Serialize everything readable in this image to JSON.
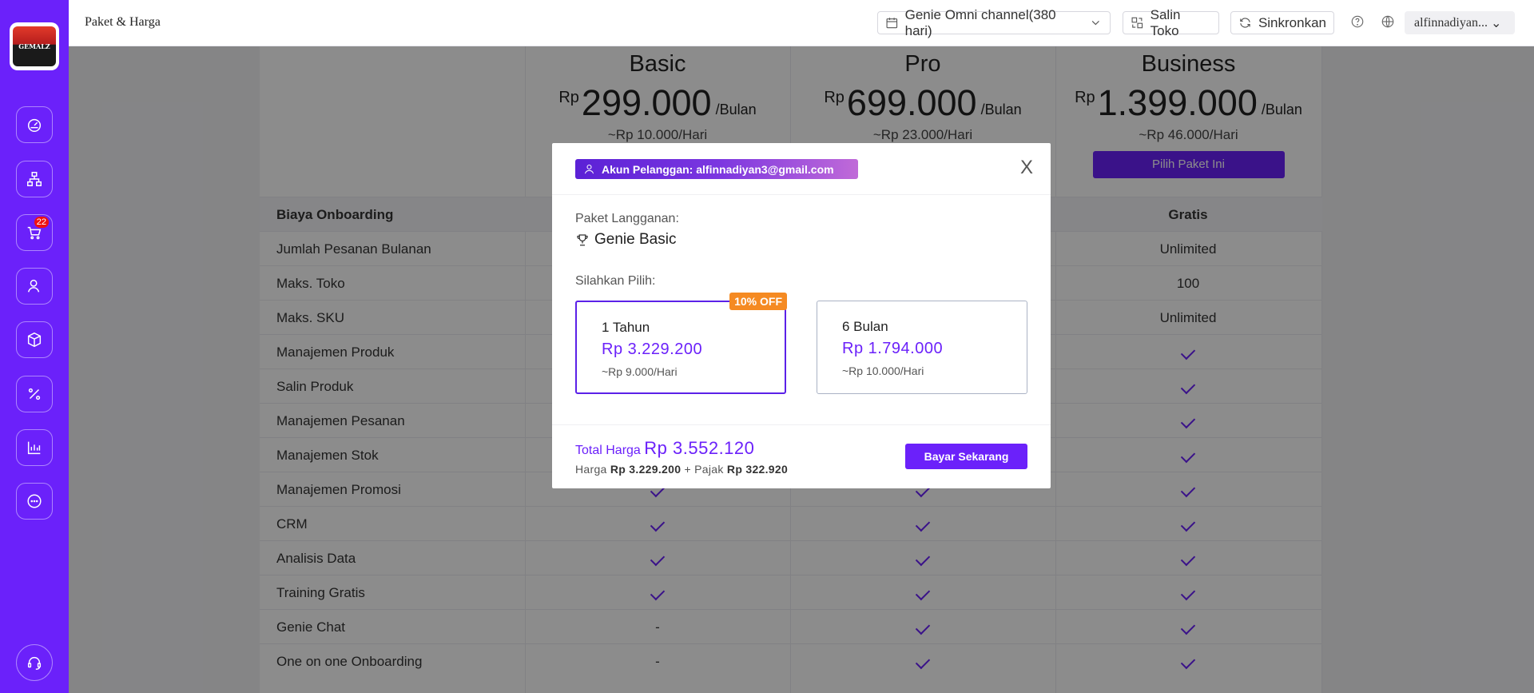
{
  "header": {
    "title": "Paket & Harga",
    "channel": "Genie Omni channel(380 hari)",
    "copy_shop": "Salin Toko",
    "sync": "Sinkronkan",
    "user": "alfinnadiyan..."
  },
  "sidebar": {
    "logo_text": "GEMALZ",
    "cart_badge": "22"
  },
  "plans": [
    {
      "name": "Basic",
      "currency": "Rp",
      "price": "299.000",
      "period": "/Bulan",
      "daily": "~Rp 10.000/Hari"
    },
    {
      "name": "Pro",
      "currency": "Rp",
      "price": "699.000",
      "period": "/Bulan",
      "daily": "~Rp 23.000/Hari"
    },
    {
      "name": "Business",
      "currency": "Rp",
      "price": "1.399.000",
      "period": "/Bulan",
      "daily": "~Rp 46.000/Hari",
      "button": "Pilih Paket Ini"
    }
  ],
  "features": [
    {
      "label": "Biaya Onboarding",
      "basic": "",
      "pro": "",
      "business": "Gratis"
    },
    {
      "label": "Jumlah Pesanan Bulanan",
      "basic": "",
      "pro": "",
      "business": "Unlimited"
    },
    {
      "label": "Maks. Toko",
      "basic": "",
      "pro": "",
      "business": "100"
    },
    {
      "label": "Maks. SKU",
      "basic": "",
      "pro": "",
      "business": "Unlimited"
    },
    {
      "label": "Manajemen Produk",
      "basic": "",
      "pro": "",
      "business": "check"
    },
    {
      "label": "Salin Produk",
      "basic": "",
      "pro": "",
      "business": "check"
    },
    {
      "label": "Manajemen Pesanan",
      "basic": "",
      "pro": "",
      "business": "check"
    },
    {
      "label": "Manajemen Stok",
      "basic": "",
      "pro": "",
      "business": "check"
    },
    {
      "label": "Manajemen Promosi",
      "basic": "check",
      "pro": "check",
      "business": "check"
    },
    {
      "label": "CRM",
      "basic": "check",
      "pro": "check",
      "business": "check"
    },
    {
      "label": "Analisis Data",
      "basic": "check",
      "pro": "check",
      "business": "check"
    },
    {
      "label": "Training Gratis",
      "basic": "check",
      "pro": "check",
      "business": "check"
    },
    {
      "label": "Genie Chat",
      "basic": "-",
      "pro": "check",
      "business": "check"
    },
    {
      "label": "One on one Onboarding",
      "basic": "-",
      "pro": "check",
      "business": "check"
    }
  ],
  "modal": {
    "account": "Akun Pelanggan: alfinnadiyan3@gmail.com",
    "close": "X",
    "package_label": "Paket Langganan:",
    "package_name": "Genie Basic",
    "choose_label": "Silahkan Pilih:",
    "options": [
      {
        "name": "1 Tahun",
        "price": "Rp 3.229.200",
        "daily": "~Rp 9.000/Hari",
        "badge": "10% OFF",
        "selected": true
      },
      {
        "name": "6 Bulan",
        "price": "Rp 1.794.000",
        "daily": "~Rp 10.000/Hari",
        "selected": false
      }
    ],
    "total_label": "Total Harga",
    "total_value": "Rp 3.552.120",
    "price_label": "Harga",
    "price_value": "Rp 3.229.200",
    "plus": "+",
    "tax_label": "Pajak",
    "tax_value": "Rp 322.920",
    "pay_button": "Bayar Sekarang"
  },
  "colors": {
    "accent": "#6b21fa",
    "badge": "#f58a22"
  }
}
